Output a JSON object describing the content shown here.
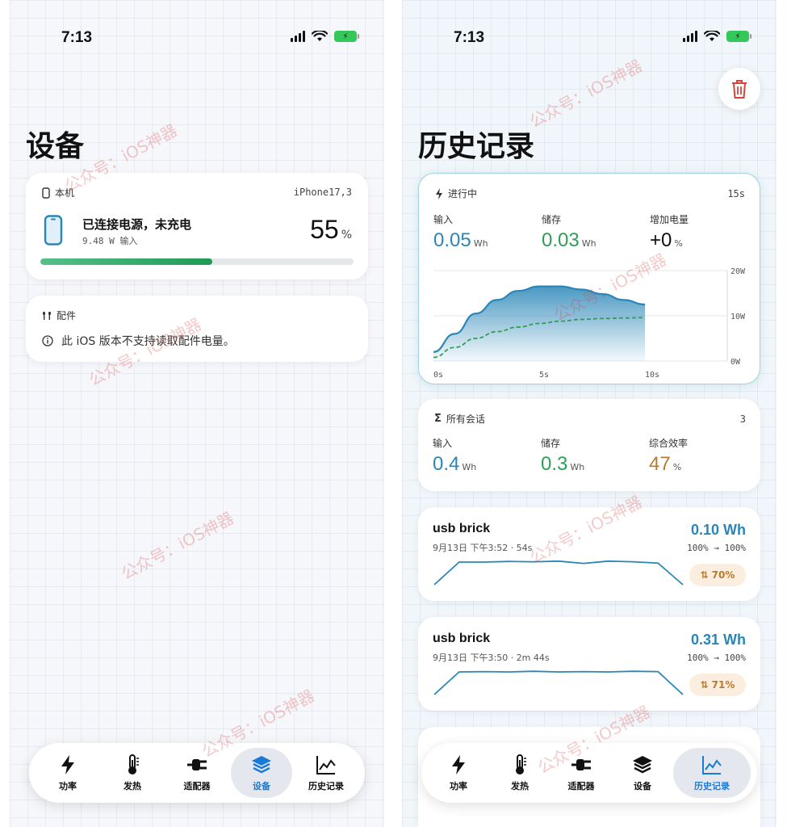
{
  "left": {
    "status": {
      "time": "7:13"
    },
    "title": "设备",
    "device_card": {
      "label": "本机",
      "model": "iPhone17,3",
      "status": "已连接电源，未充电",
      "power": "9.48 W 输入",
      "percent": "55",
      "percent_unit": "%",
      "level": 0.55
    },
    "accessory_card": {
      "label": "配件",
      "message": "此 iOS 版本不支持读取配件电量。"
    },
    "tabs": [
      {
        "label": "功率",
        "icon": "bolt-icon"
      },
      {
        "label": "发热",
        "icon": "thermometer-icon"
      },
      {
        "label": "适配器",
        "icon": "plug-icon"
      },
      {
        "label": "设备",
        "icon": "layers-icon"
      },
      {
        "label": "历史记录",
        "icon": "chart-icon"
      }
    ],
    "active_tab": "设备"
  },
  "right": {
    "status": {
      "time": "7:13"
    },
    "title": "历史记录",
    "live": {
      "label": "进行中",
      "duration": "15s",
      "input_label": "输入",
      "input_value": "0.05",
      "input_unit": "Wh",
      "stored_label": "储存",
      "stored_value": "0.03",
      "stored_unit": "Wh",
      "added_label": "增加电量",
      "added_value": "+0",
      "added_unit": "%",
      "chart": {
        "type": "area",
        "x_ticks": [
          "0s",
          "5s",
          "10s"
        ],
        "y_ticks": [
          "20W",
          "10W",
          "0W"
        ],
        "xlim": [
          0,
          10
        ],
        "ylim": [
          0,
          20
        ],
        "series": [
          {
            "x": [
              0,
              1,
              2,
              3,
              4,
              5,
              6,
              7,
              8,
              9,
              10
            ],
            "values": [
              2,
              6,
              10.5,
              13.5,
              15.5,
              16.5,
              16.5,
              15.8,
              14.8,
              13.5,
              12.5
            ]
          },
          {
            "x": [
              0,
              1,
              2,
              3,
              4,
              5,
              6,
              7,
              8,
              9,
              10
            ],
            "values": [
              0.8,
              3,
              5,
              6.5,
              7.5,
              8.3,
              8.8,
              9.2,
              9.4,
              9.5,
              9.6
            ]
          }
        ],
        "colors": [
          "#2a86b8",
          "#2e9e55"
        ]
      }
    },
    "totals": {
      "label": "所有会话",
      "count": "3",
      "input_label": "输入",
      "input_value": "0.4",
      "input_unit": "Wh",
      "stored_label": "储存",
      "stored_value": "0.3",
      "stored_unit": "Wh",
      "eff_label": "综合效率",
      "eff_value": "47",
      "eff_unit": "%"
    },
    "sessions": [
      {
        "name": "usb brick",
        "meta": "9月13日 下午3:52 · 54s",
        "energy": "0.10 Wh",
        "range": "100% → 100%",
        "efficiency": "70%",
        "spark": [
          1,
          8,
          8,
          8.2,
          8.1,
          8.3,
          7.6,
          8.3,
          8.1,
          7.7,
          1
        ]
      },
      {
        "name": "usb brick",
        "meta": "9月13日 下午3:50 · 2m 44s",
        "energy": "0.31 Wh",
        "range": "100% → 100%",
        "efficiency": "71%",
        "spark": [
          1,
          8,
          8.1,
          8,
          8.2,
          8,
          8.1,
          8,
          8.2,
          8.1,
          1
        ]
      }
    ],
    "tabs": [
      {
        "label": "功率",
        "icon": "bolt-icon"
      },
      {
        "label": "发热",
        "icon": "thermometer-icon"
      },
      {
        "label": "适配器",
        "icon": "plug-icon"
      },
      {
        "label": "设备",
        "icon": "layers-icon"
      },
      {
        "label": "历史记录",
        "icon": "chart-icon"
      }
    ],
    "active_tab": "历史记录"
  },
  "watermark": "公众号：iOS神器"
}
